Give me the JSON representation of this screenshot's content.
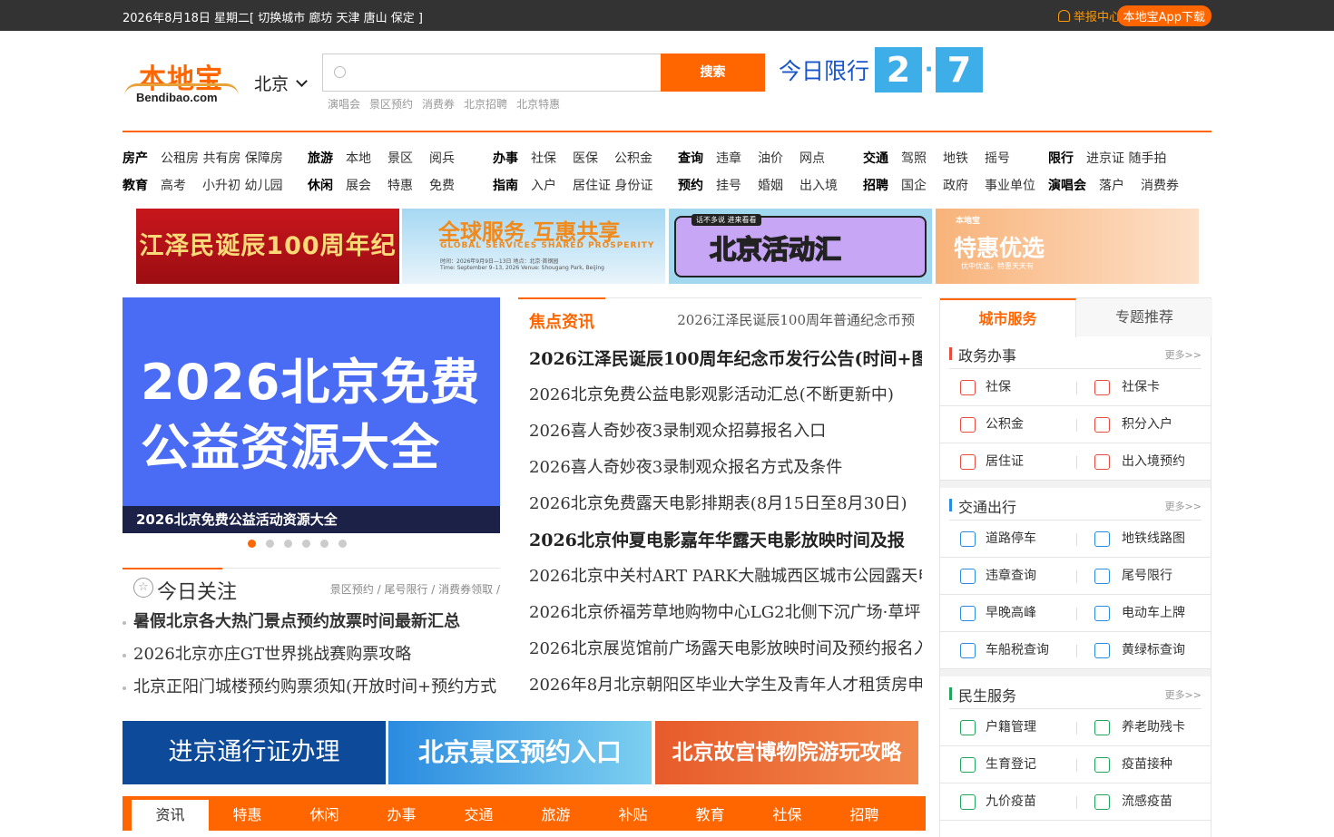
{
  "topbar": {
    "date": "2026年8月18日 星期二[ 切换城市 廊坊 天津 唐山 保定 ]",
    "report": "举报中心",
    "app": "本地宝App下载"
  },
  "header": {
    "logo_cn": "本地宝",
    "logo_en": "Bendibao.com",
    "city": "北京",
    "search_button": "搜索",
    "search_placeholder": "",
    "hotwords": [
      "演唱会",
      "景区预约",
      "消费券",
      "北京招聘",
      "北京特惠"
    ],
    "limit_label": "今日限行",
    "limit_nums": [
      "2",
      "7"
    ]
  },
  "nav": {
    "groups": [
      {
        "rows": [
          {
            "head": "房产",
            "items": [
              "公租房 共有房 保障房"
            ]
          },
          {
            "head": "教育",
            "items": [
              "高考",
              "小升初 幼儿园"
            ]
          }
        ]
      },
      {
        "rows": [
          {
            "head": "旅游",
            "items": [
              "本地",
              "景区",
              "阅兵"
            ]
          },
          {
            "head": "休闲",
            "items": [
              "展会",
              "特惠",
              "免费"
            ]
          }
        ]
      },
      {
        "rows": [
          {
            "head": "办事",
            "items": [
              "社保",
              "医保",
              "公积金"
            ]
          },
          {
            "head": "指南",
            "items": [
              "入户",
              "居住证 身份证"
            ]
          }
        ]
      },
      {
        "rows": [
          {
            "head": "查询",
            "items": [
              "违章",
              "油价",
              "网点"
            ]
          },
          {
            "head": "预约",
            "items": [
              "挂号",
              "婚姻",
              "出入境"
            ]
          }
        ]
      },
      {
        "rows": [
          {
            "head": "交通",
            "items": [
              "驾照",
              "地铁",
              "摇号"
            ]
          },
          {
            "head": "招聘",
            "items": [
              "国企",
              "政府",
              "事业单位"
            ]
          }
        ]
      },
      {
        "rows": [
          {
            "head": "限行",
            "items": [
              "进京证 随手拍"
            ]
          },
          {
            "head": "演唱会",
            "items": [
              "落户",
              "消费券"
            ]
          }
        ]
      }
    ]
  },
  "banners": {
    "b1": "江泽民诞辰100周年纪念币",
    "b2_title": "全球服务 互惠共享",
    "b2_en": "GLOBAL SERVICES SHARED PROSPERITY",
    "b2_info": "时间：2026年9月9日—13日  地点：北京·首钢园",
    "b2_info2": "Time: September 9–13, 2026  Venue: Shougang Park, Beijing",
    "b3_tag": "话不多说 进来看看",
    "b3_title": "北京活动汇",
    "b4_mini": "本地宝",
    "b4_title": "特惠优选",
    "b4_sub": "优中优选，特惠天天有"
  },
  "slide": {
    "big_line1": "2026北京免费",
    "big_line2": "公益资源大全",
    "caption": "2026北京免费公益活动资源大全",
    "dot_count": 6,
    "active_dot": 0
  },
  "today": {
    "title": "今日关注",
    "links": "景区预约 / 尾号限行 / 消费券领取 /",
    "items": [
      "暑假北京各大热门景点预约放票时间最新汇总",
      "2026北京亦庄GT世界挑战赛购票攻略",
      "北京正阳门城楼预约购票须知(开放时间+预约方式"
    ]
  },
  "focus": {
    "title": "焦点资讯",
    "subtitle": "2026江泽民诞辰100周年普通纪念币预",
    "items": [
      {
        "text": "2026江泽民诞辰100周年纪念币发行公告(时间+图",
        "bold": true
      },
      {
        "text": "2026北京免费公益电影观影活动汇总(不断更新中)",
        "bold": false
      },
      {
        "text": "2026喜人奇妙夜3录制观众招募报名入口",
        "bold": false
      },
      {
        "text": "2026喜人奇妙夜3录制观众报名方式及条件",
        "bold": false
      },
      {
        "text": "2026北京免费露天电影排期表(8月15日至8月30日)",
        "bold": false
      },
      {
        "text": "2026北京仲夏电影嘉年华露天电影放映时间及报",
        "bold": true
      },
      {
        "text": "2026北京中关村ART PARK大融城西区城市公园露天电",
        "bold": false
      },
      {
        "text": "2026北京侨福芳草地购物中心LG2北侧下沉广场·草坪",
        "bold": false
      },
      {
        "text": "2026北京展览馆前广场露天电影放映时间及预约报名入",
        "bold": false
      },
      {
        "text": "2026年8月北京朝阳区毕业大学生及青年人才租赁房申",
        "bold": false
      }
    ]
  },
  "ads": {
    "a1": "进京通行证办理",
    "a2": "北京景区预约入口",
    "a3": "北京故宫博物院游玩攻略"
  },
  "tabs": [
    "资讯",
    "特惠",
    "休闲",
    "办事",
    "交通",
    "旅游",
    "补贴",
    "教育",
    "社保",
    "招聘"
  ],
  "side": {
    "tab_on": "城市服务",
    "tab_off": "专题推荐",
    "sections": [
      {
        "name": "政务办事",
        "more": "更多>>",
        "color": "#e84c3d",
        "items": [
          "社保",
          "社保卡",
          "公积金",
          "积分入户",
          "居住证",
          "出入境预约"
        ]
      },
      {
        "name": "交通出行",
        "more": "更多>>",
        "color": "#2a8be0",
        "items": [
          "道路停车",
          "地铁线路图",
          "违章查询",
          "尾号限行",
          "早晚高峰",
          "电动车上牌",
          "车船税查询",
          "黄绿标查询"
        ]
      },
      {
        "name": "民生服务",
        "more": "更多>>",
        "color": "#22a55a",
        "items": [
          "户籍管理",
          "养老助残卡",
          "生育登记",
          "疫苗接种",
          "九价疫苗",
          "流感疫苗"
        ]
      }
    ]
  }
}
